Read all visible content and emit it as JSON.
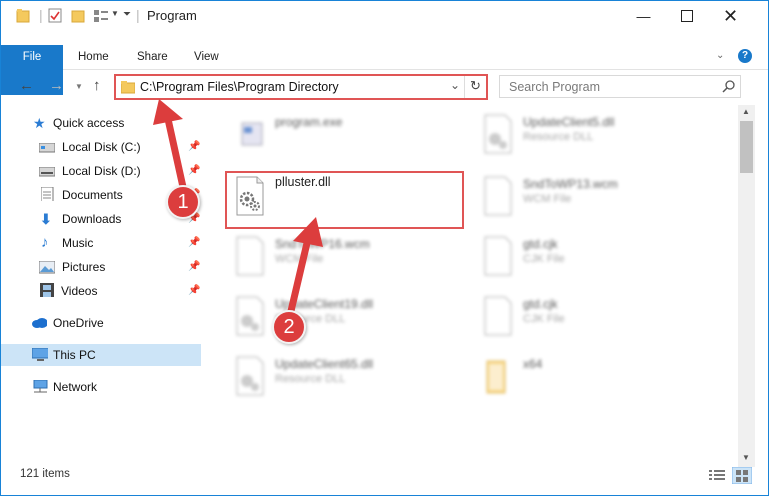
{
  "window": {
    "title": "Program"
  },
  "ribbon": {
    "tabs": [
      "File",
      "Home",
      "Share",
      "View"
    ]
  },
  "address": {
    "path": "C:\\Program Files\\Program Directory"
  },
  "search": {
    "placeholder": "Search Program"
  },
  "sidebar": {
    "items": [
      {
        "label": "Quick access",
        "pinned": false
      },
      {
        "label": "Local Disk (C:)",
        "pinned": true
      },
      {
        "label": "Local Disk (D:)",
        "pinned": true
      },
      {
        "label": "Documents",
        "pinned": true
      },
      {
        "label": "Downloads",
        "pinned": true
      },
      {
        "label": "Music",
        "pinned": true
      },
      {
        "label": "Pictures",
        "pinned": true
      },
      {
        "label": "Videos",
        "pinned": true
      },
      {
        "label": "OneDrive",
        "pinned": false
      },
      {
        "label": "This PC",
        "pinned": false,
        "selected": true
      },
      {
        "label": "Network",
        "pinned": false
      }
    ]
  },
  "files": {
    "highlighted": {
      "name": "plluster.dll"
    },
    "col1": [
      {
        "name": "program.exe",
        "type": ""
      },
      {
        "name": "SndToWP16.wcm",
        "type": "WCM File"
      },
      {
        "name": "UpdateClient19.dll",
        "type": "Resource DLL"
      },
      {
        "name": "UpdateClient65.dll",
        "type": "Resource DLL"
      }
    ],
    "col2": [
      {
        "name": "UpdateClient5.dll",
        "type": "Resource DLL"
      },
      {
        "name": "SndToWP13.wcm",
        "type": "WCM File"
      },
      {
        "name": "gtd.cjk",
        "type": "CJK File"
      },
      {
        "name": "gtd.cjk",
        "type": "CJK File"
      },
      {
        "name": "x64",
        "type": ""
      }
    ]
  },
  "status": {
    "items_count": "121 items"
  },
  "annotations": {
    "step1": "1",
    "step2": "2"
  },
  "colors": {
    "accent": "#1979ca",
    "highlight": "#e05555",
    "badge": "#dc3d3d"
  }
}
